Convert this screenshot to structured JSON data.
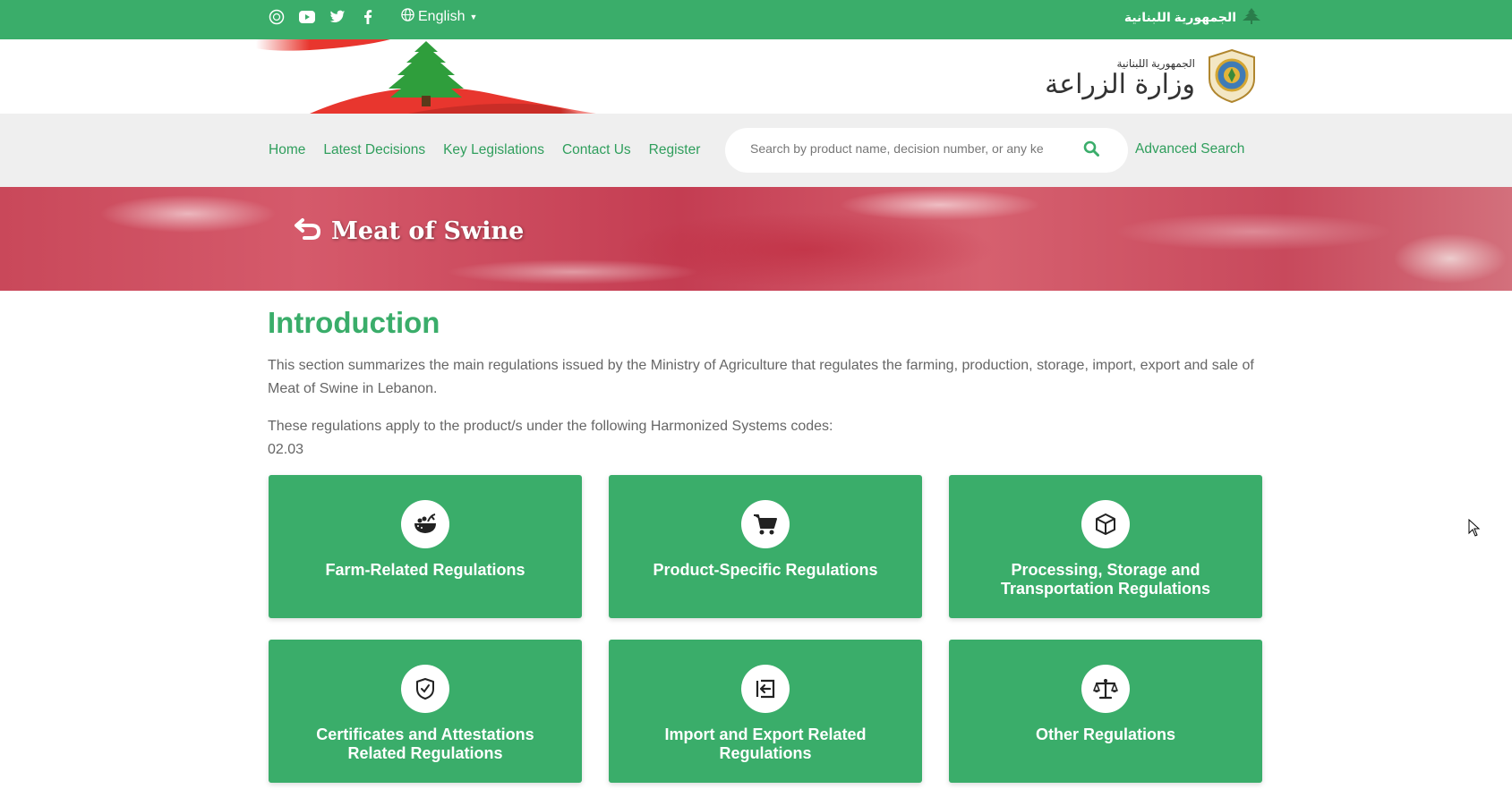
{
  "topbar": {
    "social_icons": [
      "ministry-seal-icon",
      "youtube-icon",
      "twitter-icon",
      "facebook-icon"
    ],
    "language": "English",
    "republic_label": "الجمهورية اللبنانية"
  },
  "header": {
    "ministry_small": "الجمهورية اللبنانية",
    "ministry_name": "وزارة الزراعة"
  },
  "nav": {
    "items": [
      "Home",
      "Latest Decisions",
      "Key Legislations",
      "Contact Us",
      "Register"
    ],
    "search_placeholder": "Search by product name, decision number, or any ke",
    "advanced_search": "Advanced Search"
  },
  "banner": {
    "title": "Meat of Swine"
  },
  "content": {
    "heading": "Introduction",
    "paragraph": "This section summarizes the main regulations issued by the Ministry of Agriculture that regulates the farming, production, storage, import, export and sale of Meat of Swine in Lebanon.",
    "hs_line": "These regulations apply to the product/s under the following Harmonized Systems codes:",
    "hs_code": "02.03"
  },
  "cards": [
    {
      "label": "Farm-Related Regulations",
      "icon": "farm-bowl-icon"
    },
    {
      "label": "Product-Specific Regulations",
      "icon": "cart-icon"
    },
    {
      "label": "Processing, Storage and Transportation Regulations",
      "icon": "box-icon"
    },
    {
      "label": "Certificates and Attestations Related Regulations",
      "icon": "shield-check-icon"
    },
    {
      "label": "Import and Export Related Regulations",
      "icon": "import-icon"
    },
    {
      "label": "Other Regulations",
      "icon": "scales-icon"
    }
  ],
  "colors": {
    "primary_green": "#3aad6a",
    "link_green": "#2f9e5c",
    "nav_bg": "#efefef"
  }
}
